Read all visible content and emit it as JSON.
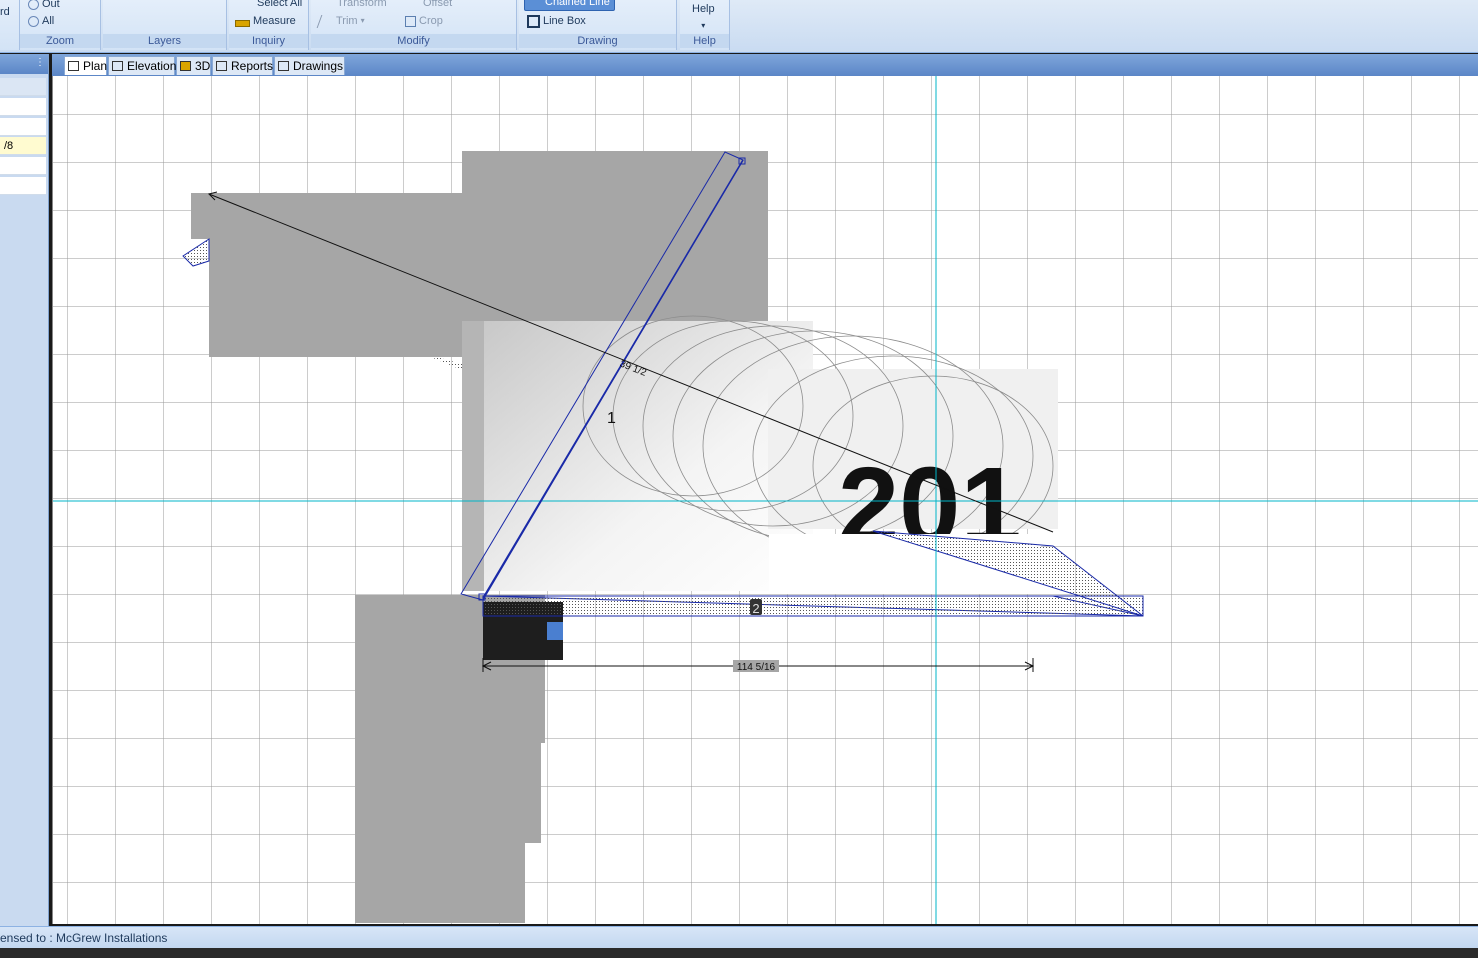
{
  "ribbon": {
    "groups": [
      {
        "label": "Zoom",
        "buttons": [
          "Out",
          "All"
        ]
      },
      {
        "label": "Layers",
        "buttons": []
      },
      {
        "label": "Inquiry",
        "buttons": [
          "Select All",
          "Measure"
        ]
      },
      {
        "label": "Modify",
        "buttons": [
          "Transform",
          "Offset",
          "Trim",
          "Crop"
        ]
      },
      {
        "label": "Drawing",
        "buttons": [
          "Chained Line",
          "Line Box"
        ]
      },
      {
        "label": "Help",
        "buttons": [
          "Help"
        ]
      }
    ],
    "partial_left_label": "rd"
  },
  "left_panel": {
    "field_value": "/8"
  },
  "tabs": [
    {
      "label": "Plan",
      "active": true
    },
    {
      "label": "Elevation",
      "active": false
    },
    {
      "label": "3D",
      "active": false
    },
    {
      "label": "Reports",
      "active": false
    },
    {
      "label": "Drawings",
      "active": false
    }
  ],
  "drawing": {
    "diagonal_dimension": "39 1/2",
    "bottom_dimension": "114 5/16",
    "piece_label_1": "1",
    "piece_label_2": "2",
    "overlay_text": "201"
  },
  "status": {
    "text": "ensed to : McGrew Installations"
  },
  "colors": {
    "accent": "#5b86c7",
    "guide": "#00b5c8",
    "countertop_outline": "#1a2aa8"
  }
}
